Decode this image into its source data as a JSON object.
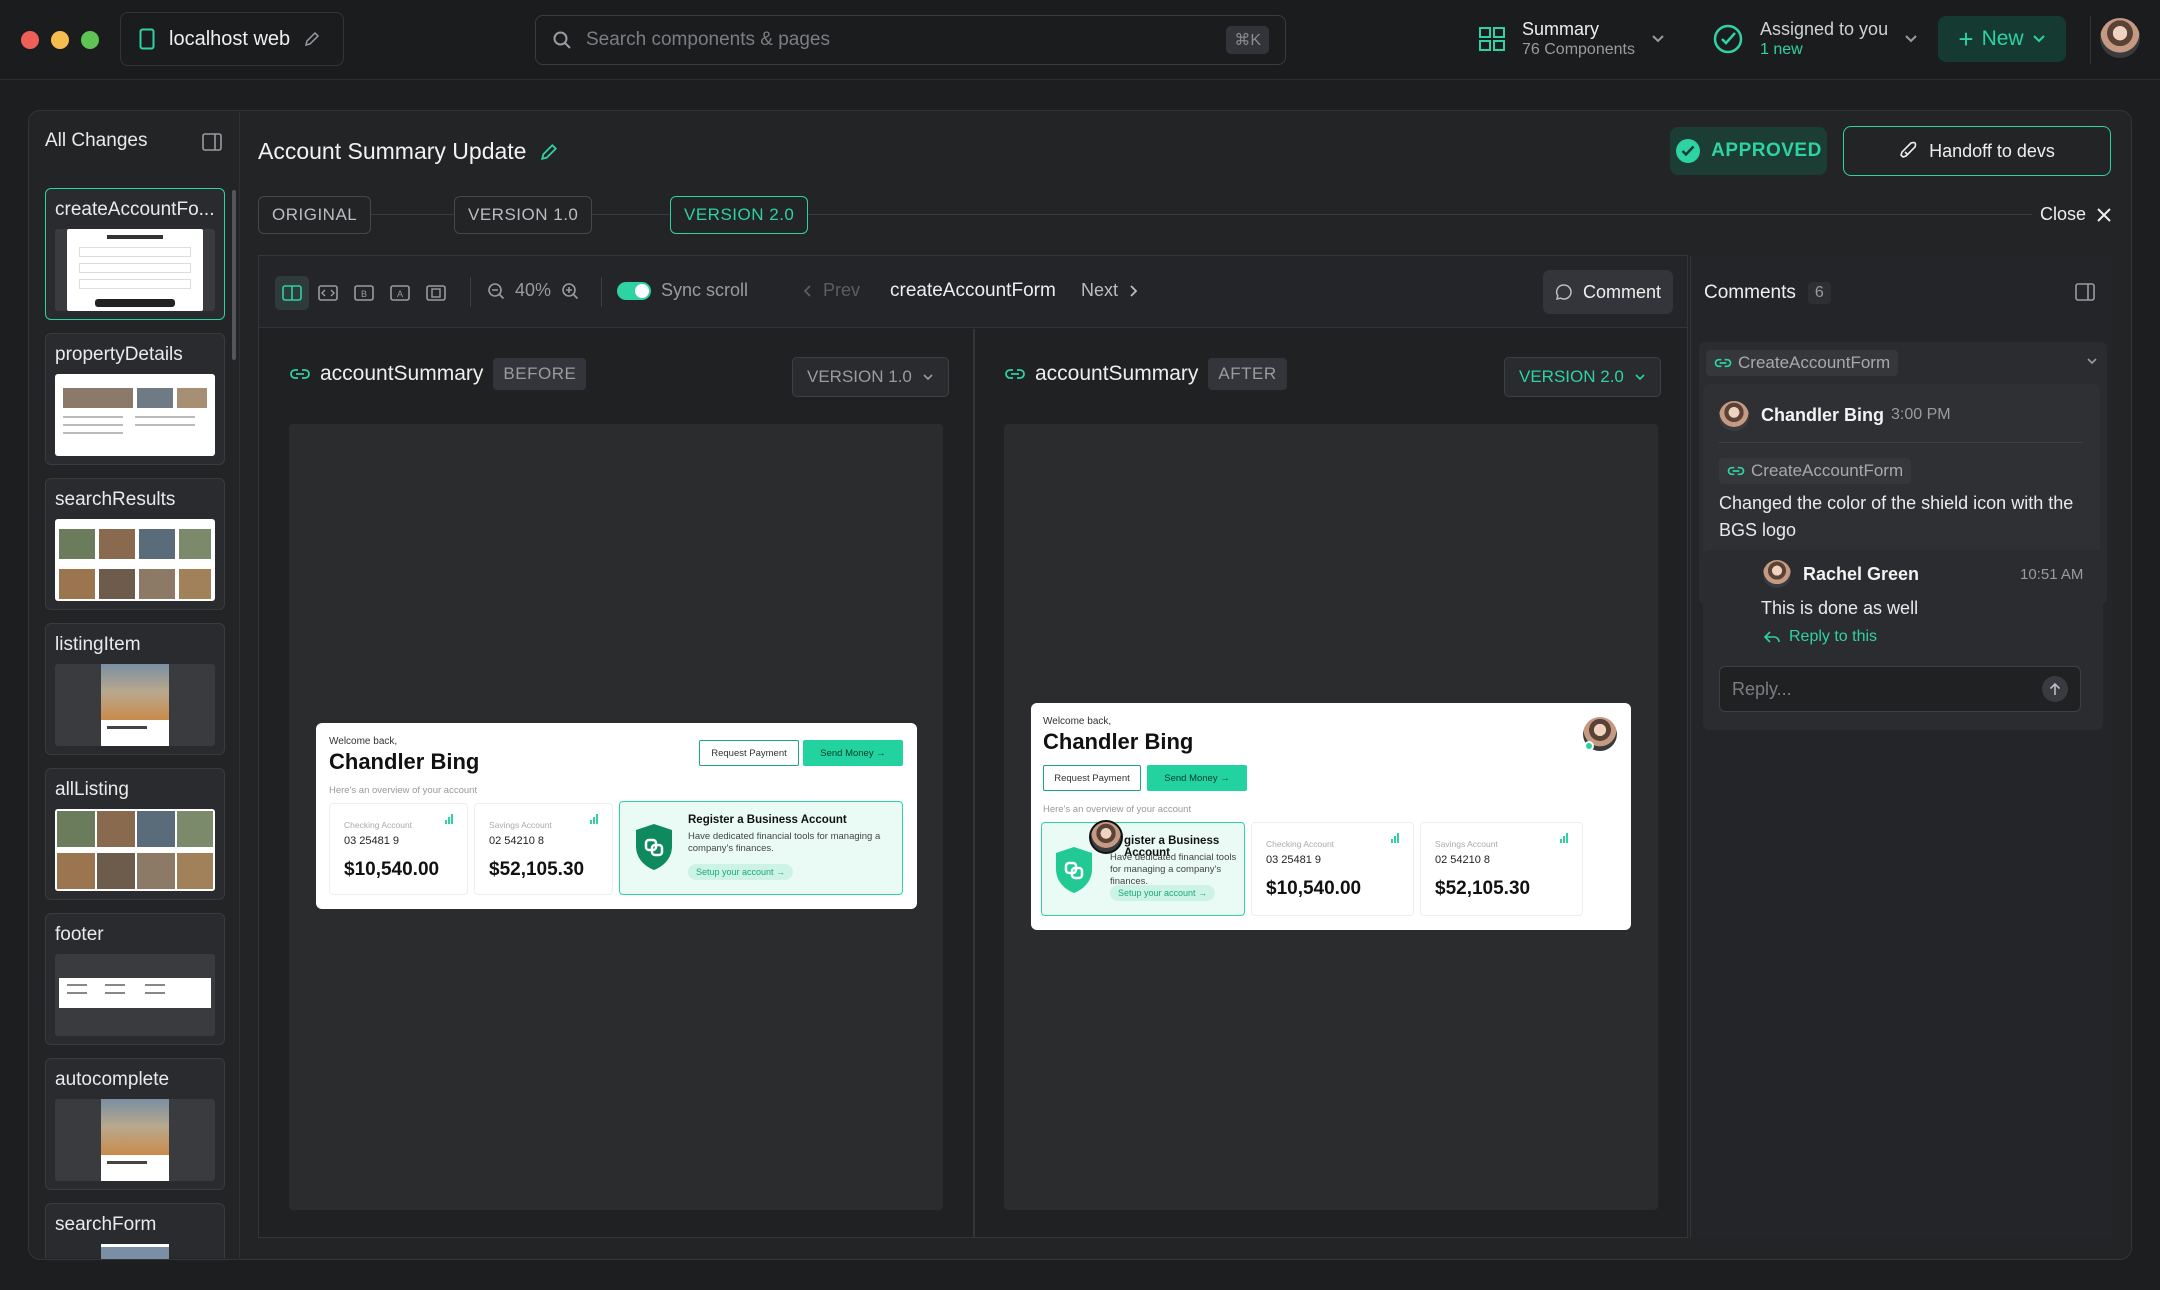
{
  "topbar": {
    "project_name": "localhost web",
    "search_placeholder": "Search components & pages",
    "search_shortcut": "⌘K",
    "summary_title": "Summary",
    "summary_sub": "76 Components",
    "assigned_title": "Assigned to you",
    "assigned_sub": "1 new",
    "new_label": "New"
  },
  "sidebar": {
    "title": "All Changes",
    "items": [
      {
        "label": "createAccountFo..."
      },
      {
        "label": "propertyDetails"
      },
      {
        "label": "searchResults"
      },
      {
        "label": "listingItem"
      },
      {
        "label": "allListing"
      },
      {
        "label": "footer"
      },
      {
        "label": "autocomplete"
      },
      {
        "label": "searchForm"
      }
    ]
  },
  "header": {
    "title": "Account Summary Update",
    "approved_label": "APPROVED",
    "handoff_label": "Handoff to devs",
    "close_label": "Close",
    "versions": [
      "ORIGINAL",
      "VERSION 1.0",
      "VERSION 2.0"
    ]
  },
  "toolbar": {
    "zoom": "40%",
    "sync_label": "Sync scroll",
    "prev_label": "Prev",
    "current": "createAccountForm",
    "next_label": "Next",
    "comment_label": "Comment"
  },
  "panes": {
    "before": {
      "component": "accountSummary",
      "tag": "BEFORE",
      "version": "VERSION 1.0"
    },
    "after": {
      "component": "accountSummary",
      "tag": "AFTER",
      "version": "VERSION 2.0"
    }
  },
  "preview": {
    "welcome": "Welcome back,",
    "name": "Chandler Bing",
    "overview": "Here's an overview of your account",
    "request_payment": "Request Payment",
    "send_money": "Send Money →",
    "checking_label": "Checking Account",
    "checking_number": "03 25481 9",
    "checking_value": "$10,540.00",
    "savings_label": "Savings Account",
    "savings_number": "02 54210 8",
    "savings_value": "$52,105.30",
    "biz_title": "Register a Business Account",
    "biz_desc": "Have dedicated financial tools for managing a company's finances.",
    "biz_cta": "Setup your account →",
    "biz_title_after": "gister a Business Account"
  },
  "comments": {
    "title": "Comments",
    "count": "6",
    "thread_ref": "CreateAccountForm",
    "author": "Chandler Bing",
    "time": "3:00 PM",
    "inner_ref": "CreateAccountForm",
    "text": "Changed the color of the shield icon with the BGS logo",
    "reply_author": "Rachel Green",
    "reply_time": "10:51 AM",
    "reply_text": "This is done as well",
    "reply_link": "Reply to this",
    "reply_placeholder": "Reply..."
  },
  "colors": {
    "accent": "#2fd2a2",
    "background": "#1d1e20"
  }
}
